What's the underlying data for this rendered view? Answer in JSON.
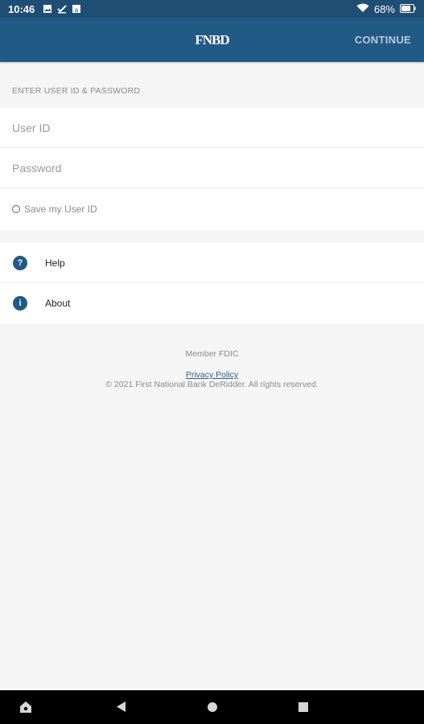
{
  "status_bar": {
    "time": "10:46",
    "battery": "68%",
    "icons": [
      "image-icon",
      "check-icon",
      "app-icon",
      "wifi-icon",
      "battery-icon"
    ]
  },
  "app_bar": {
    "logo_text": "FNBD",
    "continue_label": "CONTINUE"
  },
  "login": {
    "section_header": "ENTER USER ID & PASSWORD",
    "user_id_placeholder": "User ID",
    "password_placeholder": "Password",
    "save_user_label": "Save my User ID"
  },
  "menu": {
    "items": [
      {
        "label": "Help",
        "icon": "help-icon",
        "glyph": "?"
      },
      {
        "label": "About",
        "icon": "info-icon",
        "glyph": "i"
      }
    ]
  },
  "footer": {
    "fdic": "Member FDIC",
    "privacy": "Privacy Policy",
    "copyright": "© 2021 First National Bank DeRidder. All rights reserved."
  },
  "colors": {
    "primary": "#215a84",
    "status_bar": "#1f4e75",
    "background": "#f5f5f5"
  }
}
